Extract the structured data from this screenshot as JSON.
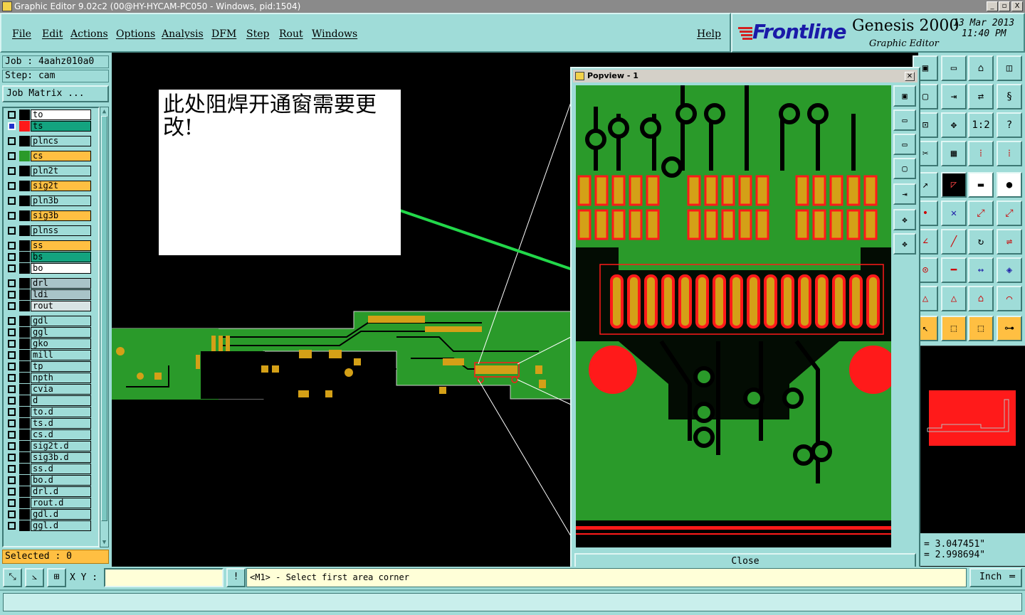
{
  "window": {
    "title": "Graphic Editor 9.02c2 (00@HY-HYCAM-PC050 - Windows, pid:1504)",
    "controls": [
      "_",
      "▫",
      "X"
    ]
  },
  "menu": {
    "items": [
      "File",
      "Edit",
      "Actions",
      "Options",
      "Analysis",
      "DFM",
      "Step",
      "Rout",
      "Windows"
    ],
    "help": "Help"
  },
  "brand": {
    "logo": "Frontline",
    "product": "Genesis 2000",
    "subtitle": "Graphic Editor",
    "date": "13 Mar 2013",
    "time": "11:40 PM"
  },
  "job": {
    "job_label": "Job : 4aahz010a0",
    "step_label": "Step: cam",
    "matrix_button": "Job Matrix ..."
  },
  "layers": [
    {
      "name": "to",
      "color": "#ffffff",
      "swatch": "#000000",
      "group": 0
    },
    {
      "name": "ts",
      "color": "#13a37f",
      "swatch": "#ff1a1a",
      "group": 0,
      "active": true
    },
    {
      "name": "plncs",
      "color": "#9fdcd8",
      "swatch": "#000000",
      "group": 1
    },
    {
      "name": "cs",
      "color": "#ffbf42",
      "swatch": "#2a9a2a",
      "group": 2
    },
    {
      "name": "pln2t",
      "color": "#9fdcd8",
      "swatch": "#000000",
      "group": 3
    },
    {
      "name": "sig2t",
      "color": "#ffbf42",
      "swatch": "#000000",
      "group": 4
    },
    {
      "name": "pln3b",
      "color": "#9fdcd8",
      "swatch": "#000000",
      "group": 5
    },
    {
      "name": "sig3b",
      "color": "#ffbf42",
      "swatch": "#000000",
      "group": 6
    },
    {
      "name": "plnss",
      "color": "#9fdcd8",
      "swatch": "#000000",
      "group": 7
    },
    {
      "name": "ss",
      "color": "#ffbf42",
      "swatch": "#000000",
      "group": 8
    },
    {
      "name": "bs",
      "color": "#13a37f",
      "swatch": "#000000",
      "group": 8
    },
    {
      "name": "bo",
      "color": "#ffffff",
      "swatch": "#000000",
      "group": 8
    },
    {
      "name": "drl",
      "color": "#a9c4c8",
      "swatch": "#000000",
      "group": 9
    },
    {
      "name": "ldi",
      "color": "#a9c4c8",
      "swatch": "#000000",
      "group": 9
    },
    {
      "name": "rout",
      "color": "#d8e4e4",
      "swatch": "#000000",
      "group": 9
    },
    {
      "name": "gdl",
      "color": "#9fdcd8",
      "swatch": "#000000",
      "group": 10
    },
    {
      "name": "ggl",
      "color": "#9fdcd8",
      "swatch": "#000000",
      "group": 10
    },
    {
      "name": "gko",
      "color": "#9fdcd8",
      "swatch": "#000000",
      "group": 10
    },
    {
      "name": "mill",
      "color": "#9fdcd8",
      "swatch": "#000000",
      "group": 10
    },
    {
      "name": "tp",
      "color": "#9fdcd8",
      "swatch": "#000000",
      "group": 10
    },
    {
      "name": "npth",
      "color": "#9fdcd8",
      "swatch": "#000000",
      "group": 10
    },
    {
      "name": "cvia",
      "color": "#9fdcd8",
      "swatch": "#000000",
      "group": 10
    },
    {
      "name": "d",
      "color": "#9fdcd8",
      "swatch": "#000000",
      "group": 10
    },
    {
      "name": "to.d",
      "color": "#9fdcd8",
      "swatch": "#000000",
      "group": 10
    },
    {
      "name": "ts.d",
      "color": "#9fdcd8",
      "swatch": "#000000",
      "group": 10
    },
    {
      "name": "cs.d",
      "color": "#9fdcd8",
      "swatch": "#000000",
      "group": 10
    },
    {
      "name": "sig2t.d",
      "color": "#9fdcd8",
      "swatch": "#000000",
      "group": 10
    },
    {
      "name": "sig3b.d",
      "color": "#9fdcd8",
      "swatch": "#000000",
      "group": 10
    },
    {
      "name": "ss.d",
      "color": "#9fdcd8",
      "swatch": "#000000",
      "group": 10
    },
    {
      "name": "bo.d",
      "color": "#9fdcd8",
      "swatch": "#000000",
      "group": 10
    },
    {
      "name": "drl.d",
      "color": "#9fdcd8",
      "swatch": "#000000",
      "group": 10
    },
    {
      "name": "rout.d",
      "color": "#9fdcd8",
      "swatch": "#000000",
      "group": 10
    },
    {
      "name": "gdl.d",
      "color": "#9fdcd8",
      "swatch": "#000000",
      "group": 10
    },
    {
      "name": "ggl.d",
      "color": "#9fdcd8",
      "swatch": "#000000",
      "group": 10
    }
  ],
  "selected": "Selected : 0",
  "annotation": {
    "text": "此处阻焊开通窗需要更改!"
  },
  "popview": {
    "title": "Popview - 1",
    "close_button": "Close"
  },
  "right_tools": {
    "labels": [
      "1:2"
    ]
  },
  "coords": {
    "x": "= 3.047451\"",
    "y": "= 2.998694\""
  },
  "status": {
    "xy_label": "X Y :",
    "xy_value": "",
    "prompt": "<M1> - Select first area corner",
    "unit": "Inch",
    "info_button": "!"
  },
  "colors": {
    "panel": "#9fdcd8",
    "copper": "#2a9a2a",
    "pad": "#d4a017",
    "mask": "#ff1a1a"
  }
}
